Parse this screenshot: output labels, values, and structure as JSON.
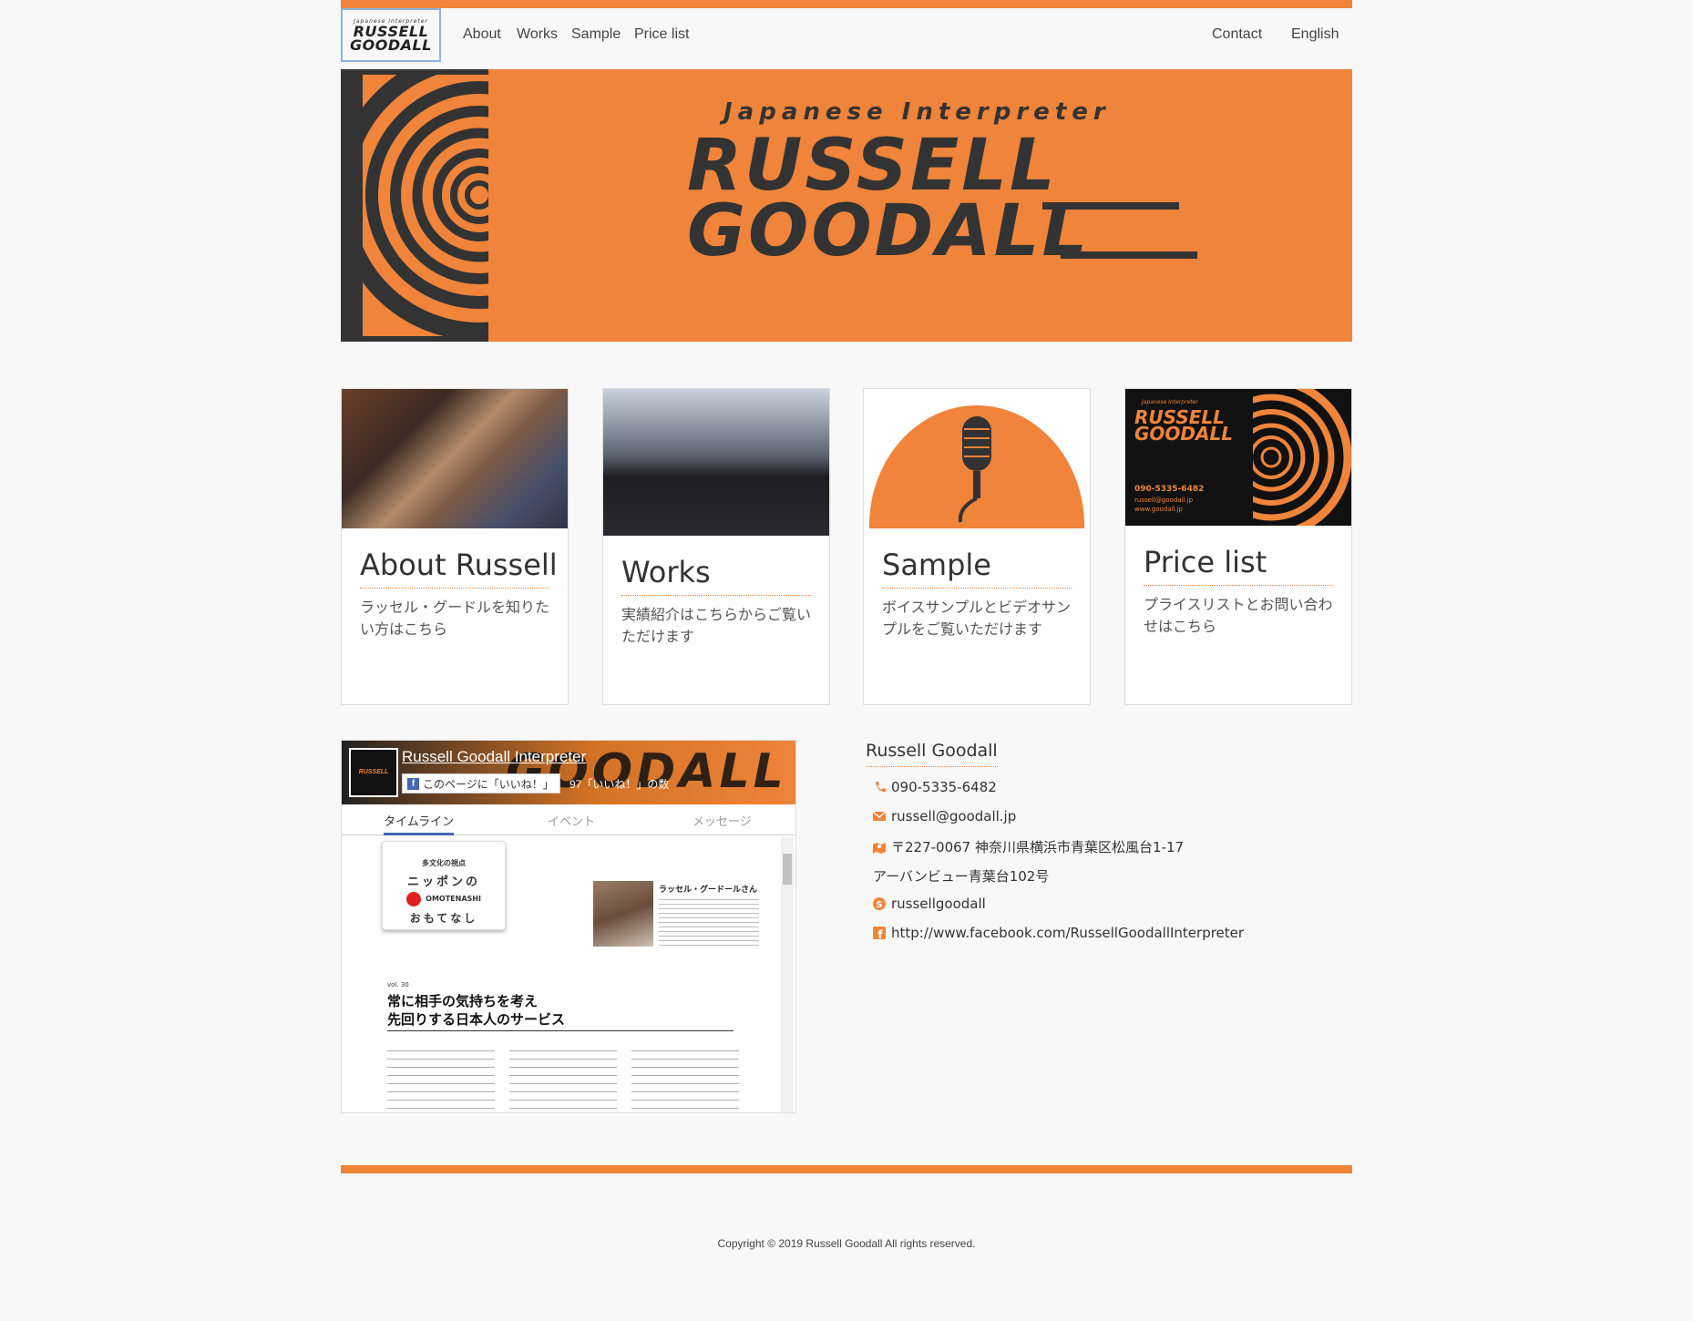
{
  "nav": {
    "logo_small": "Japanese Interpreter",
    "logo_line1": "RUSSELL",
    "logo_line2": "GOODALL",
    "links": [
      "About",
      "Works",
      "Sample",
      "Price list"
    ],
    "contact": "Contact",
    "language": "English"
  },
  "hero": {
    "tagline": "Japanese  Interpreter",
    "name_line1": "RUSSELL",
    "name_line2": "GOODALL"
  },
  "cards": [
    {
      "title": "About Russell",
      "text": "ラッセル・グードルを知りたい方はこちら"
    },
    {
      "title": "Works",
      "text": "実績紹介はこちらからご覧いただけます"
    },
    {
      "title": "Sample",
      "text": "ボイスサンプルとビデオサンプルをご覧いただけます"
    },
    {
      "title": "Price list",
      "text": "プライスリストとお問い合わせはこちら",
      "card_text": {
        "small": "Japanese Interpreter",
        "line1": "RUSSELL",
        "line2": "GOODALL",
        "phone": "090-5335-6482",
        "email": "russell@goodall.jp",
        "web": "www.goodall.jp"
      }
    }
  ],
  "facebook": {
    "page_name": "Russell Goodall Interpreter",
    "like_button": "このページに「いいね！」",
    "like_count": "97「いいね！」の数",
    "tabs": [
      "タイムライン",
      "イベント",
      "メッセージ"
    ],
    "post": {
      "badge_l1": "多文化の視点",
      "badge_l2": "ニッポンの",
      "badge_l3": "OMOTENASHI",
      "badge_l4": "おもてなし",
      "author": "ラッセル・グードールさん",
      "vol": "vol. 30",
      "headline_1": "常に相手の気持ちを考え",
      "headline_2": "先回りする日本人のサービス"
    }
  },
  "contact": {
    "name": "Russell Goodall",
    "phone": "090-5335-6482",
    "email": "russell@goodall.jp",
    "address_1": "〒227-0067 神奈川県横浜市青葉区松風台1-17",
    "address_2": "アーバンビュー青葉台102号",
    "skype": "russellgoodall",
    "facebook": "http://www.facebook.com/RussellGoodallInterpreter"
  },
  "footer": {
    "copyright": "Copyright © 2019 Russell Goodall All rights reserved."
  },
  "colors": {
    "accent": "#ef843a",
    "dark": "#333333",
    "facebook": "#4267b2"
  }
}
